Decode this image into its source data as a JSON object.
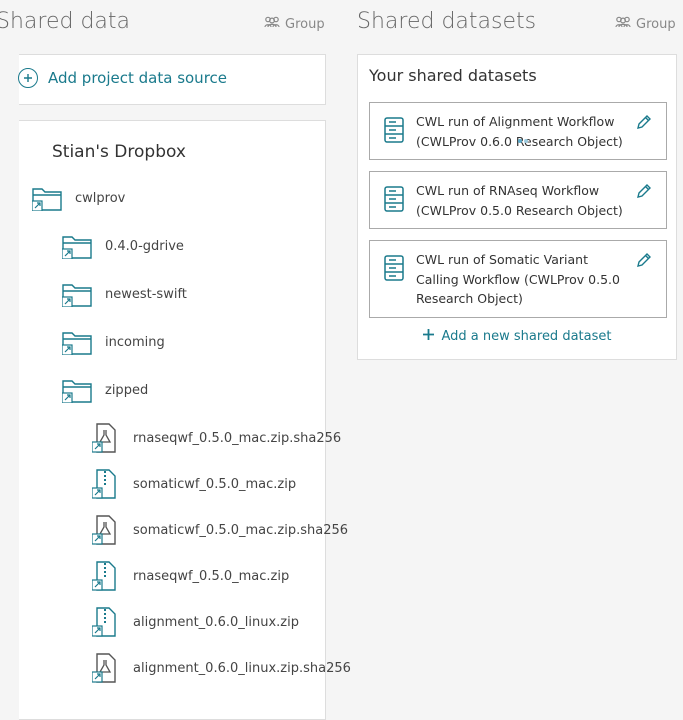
{
  "left_column": {
    "title": "Shared data",
    "group_label": "Group",
    "add_source_label": "Add project data source",
    "dropbox": {
      "title": "Stian's Dropbox",
      "items": [
        {
          "label": "cwlprov",
          "icon": "folder-link-icon"
        },
        {
          "label": "0.4.0-gdrive",
          "icon": "folder-link-icon"
        },
        {
          "label": "newest-swift",
          "icon": "folder-link-icon"
        },
        {
          "label": "incoming",
          "icon": "folder-link-icon"
        },
        {
          "label": "zipped",
          "icon": "folder-link-icon"
        },
        {
          "label": "rnaseqwf_0.5.0_mac.zip.sha256",
          "icon": "flask-file-link-icon"
        },
        {
          "label": "somaticwf_0.5.0_mac.zip",
          "icon": "zip-file-link-icon"
        },
        {
          "label": "somaticwf_0.5.0_mac.zip.sha256",
          "icon": "flask-file-link-icon"
        },
        {
          "label": "rnaseqwf_0.5.0_mac.zip",
          "icon": "zip-file-link-icon"
        },
        {
          "label": "alignment_0.6.0_linux.zip",
          "icon": "zip-file-link-icon"
        },
        {
          "label": "alignment_0.6.0_linux.zip.sha256",
          "icon": "flask-file-link-icon"
        }
      ]
    }
  },
  "right_column": {
    "title": "Shared datasets",
    "group_label": "Group",
    "panel_heading": "Your shared datasets",
    "datasets": [
      {
        "title": "CWL run of Alignment Workflow (CWLProv 0.6.0 Research Object)"
      },
      {
        "title": "CWL run of RNAseq Workflow (CWLProv 0.5.0 Research Object)"
      },
      {
        "title": "CWL run of Somatic Variant Calling Workflow (CWLProv 0.5.0 Research Object)"
      }
    ],
    "add_dataset_label": "Add a new shared dataset"
  },
  "colors": {
    "accent": "#1a7a8c",
    "muted": "#888888",
    "border": "#dddddd"
  }
}
